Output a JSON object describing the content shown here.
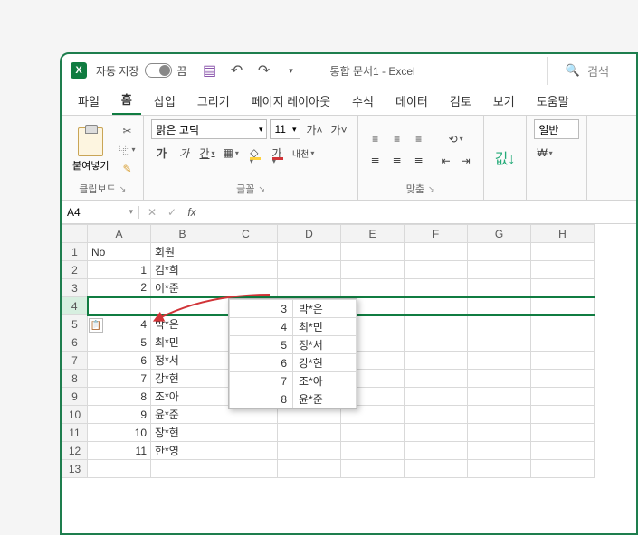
{
  "app": {
    "icon_letter": "X",
    "autosave_label": "자동 저장",
    "autosave_state": "끔",
    "doc_title": "통합 문서1 - Excel",
    "search_placeholder": "검색"
  },
  "tabs": [
    "파일",
    "홈",
    "삽입",
    "그리기",
    "페이지 레이아웃",
    "수식",
    "데이터",
    "검토",
    "보기",
    "도움말"
  ],
  "active_tab": 1,
  "ribbon": {
    "clipboard": {
      "paste": "붙여넣기",
      "label": "클립보드"
    },
    "font": {
      "name": "맑은 고딕",
      "size": "11",
      "grow": "가˄",
      "shrink": "가˅",
      "bold": "가",
      "italic": "가",
      "underline": "간",
      "ruby": "내천",
      "label": "글꼴",
      "color_char": "가",
      "fill_char": "◇",
      "border_char": "▦"
    },
    "align": {
      "label": "맞춤"
    },
    "sort": {
      "icon": "깂↓",
      "label": ""
    },
    "number": {
      "label": "일반",
      "currency": "₩"
    }
  },
  "namebox": "A4",
  "columns": [
    "A",
    "B",
    "C",
    "D",
    "E",
    "F",
    "G",
    "H"
  ],
  "rows": [
    {
      "n": 1,
      "a": "No",
      "b": "회원",
      "a_align": "txt"
    },
    {
      "n": 2,
      "a": "1",
      "b": "김*희"
    },
    {
      "n": 3,
      "a": "2",
      "b": "이*준"
    },
    {
      "n": 4,
      "a": "",
      "b": ""
    },
    {
      "n": 5,
      "a": "4",
      "b": "박*은"
    },
    {
      "n": 6,
      "a": "5",
      "b": "최*민"
    },
    {
      "n": 7,
      "a": "6",
      "b": "정*서"
    },
    {
      "n": 8,
      "a": "7",
      "b": "강*현"
    },
    {
      "n": 9,
      "a": "8",
      "b": "조*아"
    },
    {
      "n": 10,
      "a": "9",
      "b": "윤*준"
    },
    {
      "n": 11,
      "a": "10",
      "b": "장*현"
    },
    {
      "n": 12,
      "a": "11",
      "b": "한*영"
    },
    {
      "n": 13,
      "a": "",
      "b": ""
    }
  ],
  "preview": [
    {
      "a": "3",
      "b": "박*은"
    },
    {
      "a": "4",
      "b": "최*민"
    },
    {
      "a": "5",
      "b": "정*서"
    },
    {
      "a": "6",
      "b": "강*현"
    },
    {
      "a": "7",
      "b": "조*아"
    },
    {
      "a": "8",
      "b": "윤*준"
    }
  ]
}
